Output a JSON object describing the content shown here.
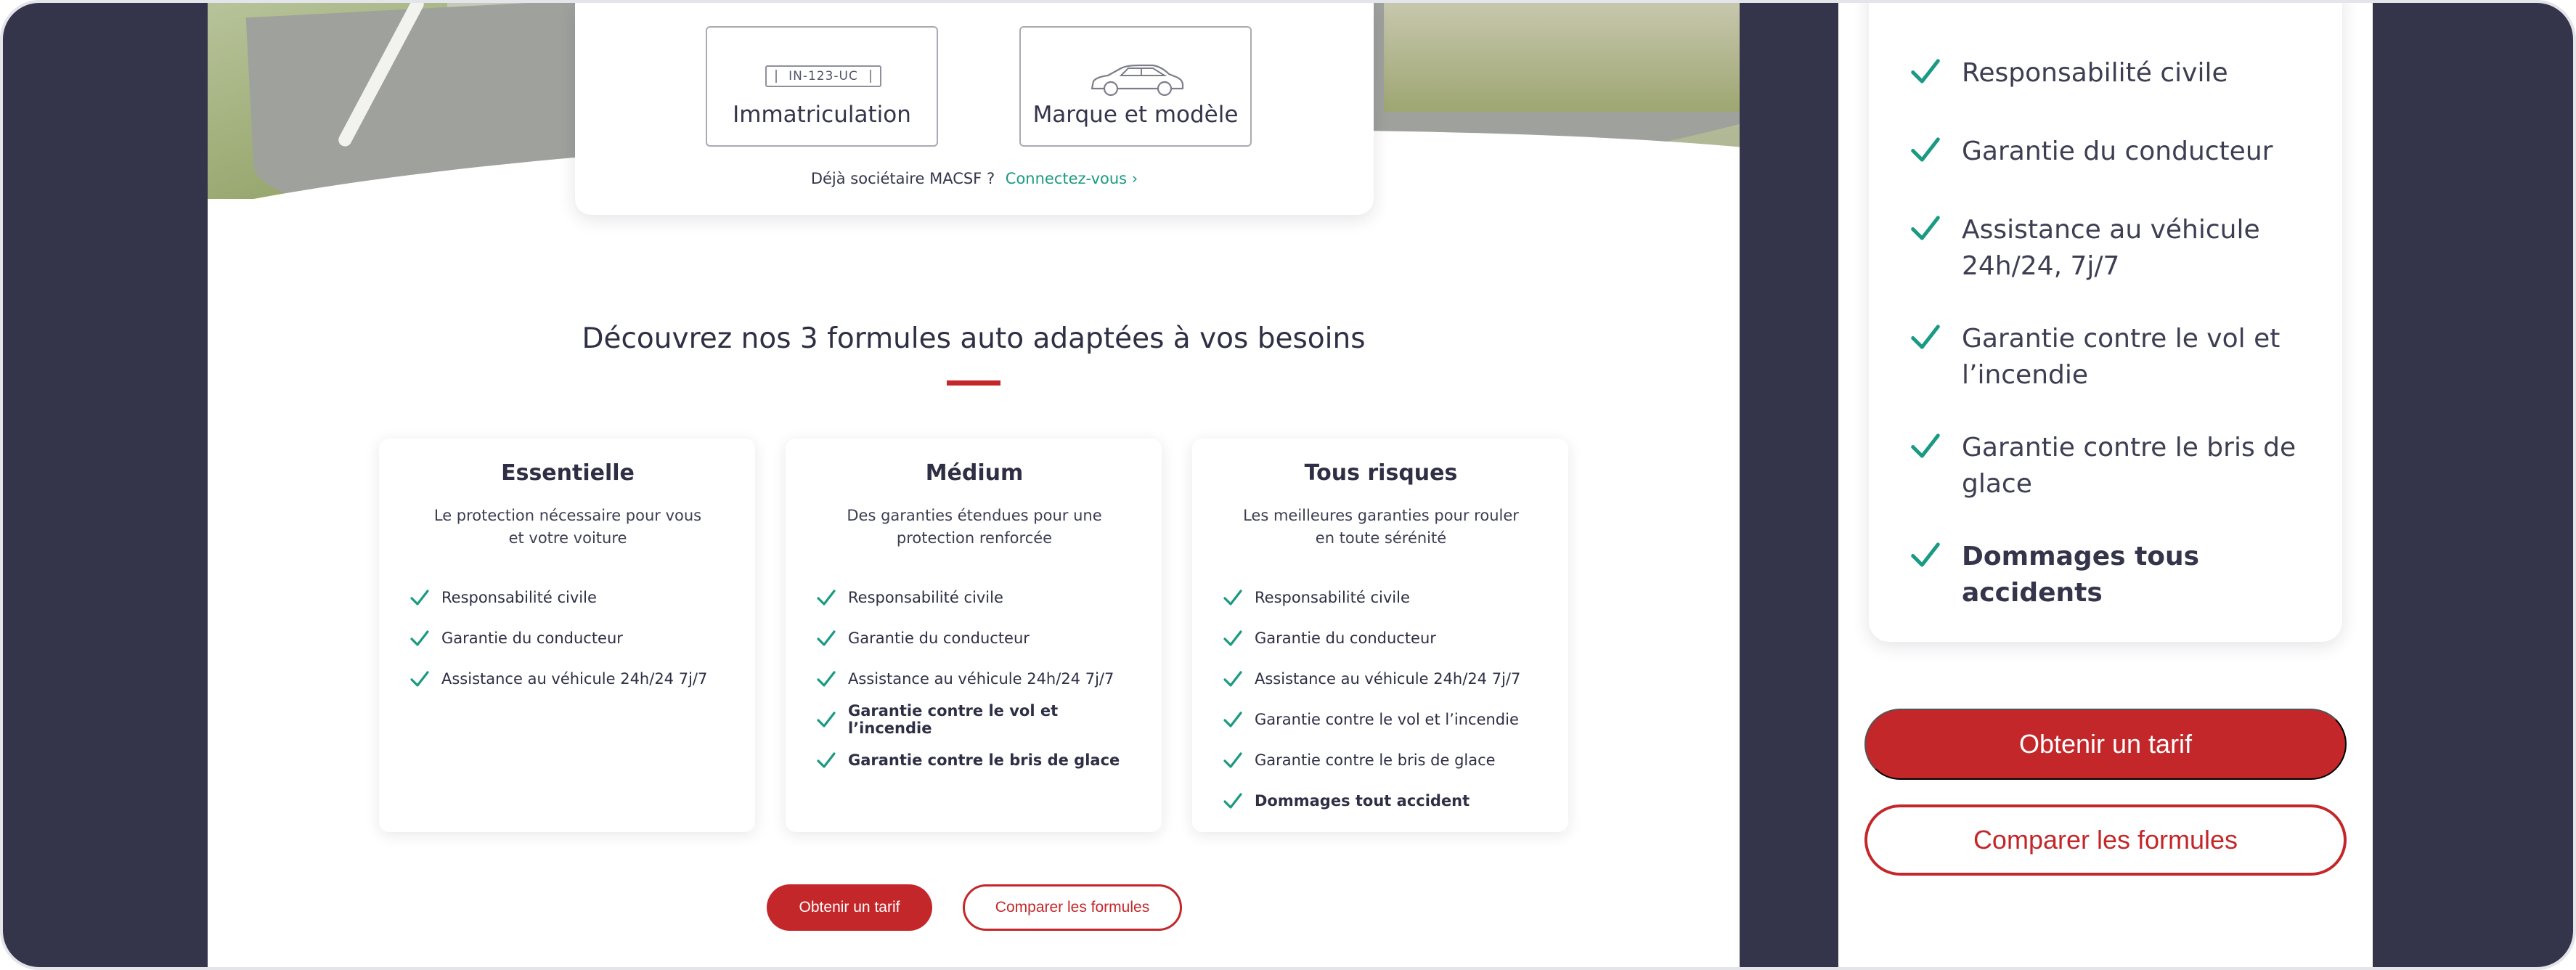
{
  "search": {
    "plate_option": {
      "plate_text": "IN-123-UC",
      "label": "Immatriculation"
    },
    "model_option": {
      "label": "Marque et modèle"
    },
    "member_prompt": "Déjà sociétaire MACSF ?",
    "member_link": "Connectez-vous ›"
  },
  "section": {
    "title": "Découvrez nos 3 formules auto adaptées à vos besoins"
  },
  "plans": [
    {
      "name": "Essentielle",
      "description": "Le protection nécessaire pour vous et votre voiture",
      "features": [
        {
          "label": "Responsabilité civile",
          "bold": false
        },
        {
          "label": "Garantie du conducteur",
          "bold": false
        },
        {
          "label": "Assistance au véhicule 24h/24 7j/7",
          "bold": false
        }
      ]
    },
    {
      "name": "Médium",
      "description": "Des garanties étendues pour une protection renforcée",
      "features": [
        {
          "label": "Responsabilité civile",
          "bold": false
        },
        {
          "label": "Garantie du conducteur",
          "bold": false
        },
        {
          "label": "Assistance au véhicule 24h/24 7j/7",
          "bold": false
        },
        {
          "label": "Garantie contre le vol et l’incendie",
          "bold": true
        },
        {
          "label": "Garantie contre le bris de glace",
          "bold": true
        }
      ]
    },
    {
      "name": "Tous risques",
      "description": "Les meilleures garanties pour rouler en toute sérénité",
      "features": [
        {
          "label": "Responsabilité civile",
          "bold": false
        },
        {
          "label": "Garantie du conducteur",
          "bold": false
        },
        {
          "label": "Assistance au véhicule 24h/24 7j/7",
          "bold": false
        },
        {
          "label": "Garantie contre le vol et l’incendie",
          "bold": false
        },
        {
          "label": "Garantie contre le bris de glace",
          "bold": false
        },
        {
          "label": "Dommages tout accident",
          "bold": true
        }
      ]
    }
  ],
  "actions": {
    "get_quote": "Obtenir un tarif",
    "compare": "Comparer les formules"
  },
  "mobile": {
    "features": [
      {
        "label": "Responsabilité civile",
        "bold": false
      },
      {
        "label": "Garantie du conducteur",
        "bold": false
      },
      {
        "label": "Assistance au véhicule 24h/24, 7j/7",
        "bold": false
      },
      {
        "label": "Garantie contre le vol et l’incendie",
        "bold": false
      },
      {
        "label": "Garantie contre le bris de glace",
        "bold": false
      },
      {
        "label": "Dommages tous accidents",
        "bold": true
      }
    ],
    "get_quote": "Obtenir un tarif",
    "compare": "Comparer les formules"
  },
  "icons": {
    "check": "check-icon",
    "car": "car-icon",
    "plate": "license-plate-icon"
  },
  "colors": {
    "brand_red": "#c4272a",
    "check_green": "#1a9a82",
    "frame_navy": "#34354b"
  }
}
